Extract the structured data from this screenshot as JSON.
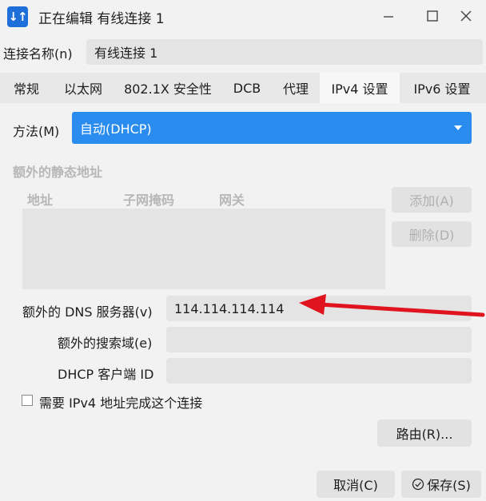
{
  "window": {
    "title": "正在编辑 有线连接 1",
    "app_icon_glyph": "↓↑"
  },
  "connection": {
    "name_label": "连接名称(n)",
    "name_value": "有线连接 1"
  },
  "tabs": [
    {
      "label": "常规"
    },
    {
      "label": "以太网"
    },
    {
      "label": "802.1X 安全性"
    },
    {
      "label": "DCB"
    },
    {
      "label": "代理"
    },
    {
      "label": "IPv4 设置",
      "active": true
    },
    {
      "label": "IPv6 设置"
    }
  ],
  "ipv4": {
    "method_label": "方法(M)",
    "method_value": "自动(DHCP)",
    "static_section_title": "额外的静态地址",
    "columns": [
      "地址",
      "子网掩码",
      "网关"
    ],
    "add_button": "添加(A)",
    "delete_button": "删除(D)",
    "dns_label": "额外的 DNS 服务器(v)",
    "dns_value": "114.114.114.114",
    "search_label": "额外的搜索域(e)",
    "search_value": "",
    "dhcp_id_label": "DHCP 客户端 ID",
    "dhcp_id_value": "",
    "require_label": "需要 IPv4 地址完成这个连接",
    "require_checked": false,
    "routes_button": "路由(R)..."
  },
  "footer": {
    "cancel_button": "取消(C)",
    "save_button": "保存(S)"
  },
  "colors": {
    "accent": "#2b8cf0",
    "annotation_arrow": "#e0141e"
  }
}
